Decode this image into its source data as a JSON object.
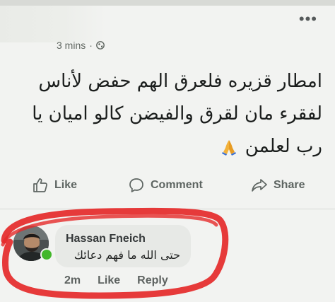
{
  "post": {
    "timestamp": "3 mins",
    "separator": "·",
    "privacy_icon": "globe-icon",
    "menu_icon": "more-dots",
    "lines": [
      "امطار قزيره فلعرق الهم حفض  لأناس",
      "لفقرء مان لقرق والفيضن كالو اميان يا",
      "رب لعلمن"
    ],
    "emoji": "folded-hands"
  },
  "actions": {
    "like": "Like",
    "comment": "Comment",
    "share": "Share"
  },
  "comment": {
    "author": "Hassan Fneich",
    "text": "حتى الله ما فهم دعائك",
    "age": "2m",
    "like": "Like",
    "reply": "Reply"
  },
  "colors": {
    "background": "#f2f3f1",
    "text": "#1b1e1d",
    "muted": "#5e6562",
    "annotation": "#e52a2a",
    "online": "#42b72a"
  }
}
